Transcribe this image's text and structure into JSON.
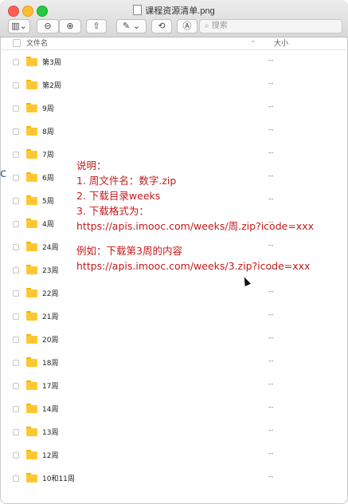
{
  "window": {
    "title": "课程资源清单.png"
  },
  "toolbar": {
    "search_placeholder": "搜索",
    "buttons": [
      {
        "name": "sidebar-toggle-button",
        "icon": "sidebar-icon"
      },
      {
        "name": "zoom-out-button",
        "icon": "zoom-out-icon"
      },
      {
        "name": "zoom-in-button",
        "icon": "zoom-in-icon"
      },
      {
        "name": "share-button",
        "icon": "share-icon"
      },
      {
        "name": "markup-button",
        "icon": "pen-icon"
      },
      {
        "name": "rotate-button",
        "icon": "rotate-icon"
      },
      {
        "name": "annotate-button",
        "icon": "annotate-icon"
      }
    ]
  },
  "columns": {
    "name": "文件名",
    "size": "大小"
  },
  "rows": [
    {
      "label": "第3周",
      "size": "--"
    },
    {
      "label": "第2周",
      "size": "--"
    },
    {
      "label": "9周",
      "size": "--"
    },
    {
      "label": "8周",
      "size": "--"
    },
    {
      "label": "7周",
      "size": "--"
    },
    {
      "label": "6周",
      "size": "--"
    },
    {
      "label": "5周",
      "size": "--"
    },
    {
      "label": "4周",
      "size": "--"
    },
    {
      "label": "24周",
      "size": "--"
    },
    {
      "label": "23周",
      "size": "--"
    },
    {
      "label": "22周",
      "size": "--"
    },
    {
      "label": "21周",
      "size": "--"
    },
    {
      "label": "20周",
      "size": "--"
    },
    {
      "label": "18周",
      "size": "--"
    },
    {
      "label": "17周",
      "size": "--"
    },
    {
      "label": "14周",
      "size": "--"
    },
    {
      "label": "13周",
      "size": "--"
    },
    {
      "label": "12周",
      "size": "--"
    },
    {
      "label": "10和11周",
      "size": "--"
    }
  ],
  "note": {
    "line1": "说明：",
    "line2": "1. 周文件名：数字.zip",
    "line3": "2. 下载目录weeks",
    "line4": "3. 下载格式为：",
    "line5": "https://apis.imooc.com/weeks/周.zip?icode=xxx",
    "line6": "例如：下载第3周的内容",
    "line7": "https://apis.imooc.com/weeks/3.zip?icode=xxx",
    "color": "#c41a1a"
  },
  "stray_char": "c"
}
